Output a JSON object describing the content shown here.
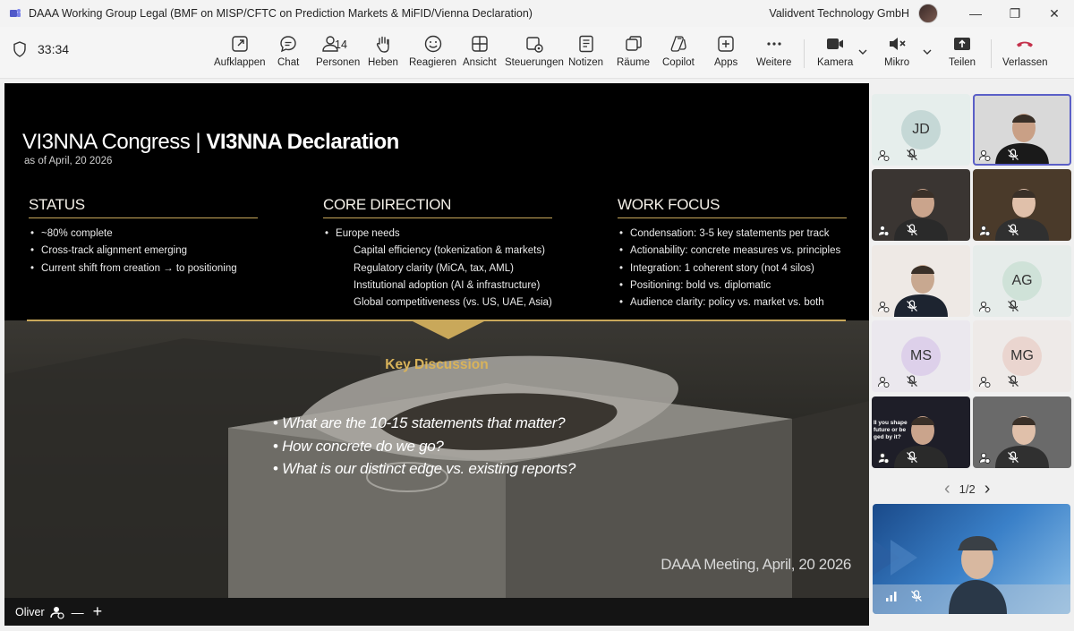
{
  "window": {
    "title": "DAAA Working Group Legal (BMF on MISP/CFTC on Prediction Markets & MiFID/Vienna Declaration)",
    "org": "Validvent Technology GmbH",
    "minimize_glyph": "—",
    "restore_glyph": "❐",
    "close_glyph": "✕"
  },
  "toolbar": {
    "timer": "33:34",
    "buttons": [
      {
        "label": "Aufklappen",
        "icon": "popout-icon"
      },
      {
        "label": "Chat",
        "icon": "chat-icon"
      },
      {
        "label": "Personen",
        "icon": "people-icon",
        "count": "14"
      },
      {
        "label": "Heben",
        "icon": "raise-hand-icon"
      },
      {
        "label": "Reagieren",
        "icon": "smiley-icon"
      },
      {
        "label": "Ansicht",
        "icon": "grid-view-icon"
      },
      {
        "label": "Steuerungen",
        "icon": "controls-icon"
      },
      {
        "label": "Notizen",
        "icon": "notes-icon"
      },
      {
        "label": "Räume",
        "icon": "rooms-icon"
      },
      {
        "label": "Copilot",
        "icon": "copilot-icon"
      },
      {
        "label": "Apps",
        "icon": "apps-icon"
      },
      {
        "label": "Weitere",
        "icon": "more-icon"
      }
    ],
    "kamera": "Kamera",
    "mikro": "Mikro",
    "teilen": "Teilen",
    "verlassen": "Verlassen",
    "leave_color": "#c4314b"
  },
  "slide": {
    "title_light": "VI3NNA Congress | ",
    "title_bold": "VI3NNA Declaration",
    "date": "as of April, 20 2026",
    "columns": [
      {
        "heading": "STATUS",
        "items": [
          {
            "text": "~80% complete",
            "sub": false
          },
          {
            "text": "Cross-track alignment emerging",
            "sub": false
          },
          {
            "text": "Current shift from creation → to positioning",
            "sub": false
          }
        ]
      },
      {
        "heading": "CORE DIRECTION",
        "items": [
          {
            "text": "Europe needs",
            "sub": false
          },
          {
            "text": "Capital efficiency (tokenization & markets)",
            "sub": true
          },
          {
            "text": "Regulatory clarity (MiCA, tax, AML)",
            "sub": true
          },
          {
            "text": "Institutional adoption (AI & infrastructure)",
            "sub": true
          },
          {
            "text": "Global competitiveness (vs. US, UAE, Asia)",
            "sub": true
          }
        ]
      },
      {
        "heading": "WORK FOCUS",
        "items": [
          {
            "text": "Condensation: 3-5 key statements per track",
            "sub": false
          },
          {
            "text": "Actionability: concrete measures vs. principles",
            "sub": false
          },
          {
            "text": "Integration: 1 coherent story (not 4 silos)",
            "sub": false
          },
          {
            "text": "Positioning: bold vs. diplomatic",
            "sub": false
          },
          {
            "text": "Audience clarity: policy vs. market vs. both",
            "sub": false
          }
        ]
      }
    ],
    "key_discussion": "Key Discussion",
    "questions": [
      "What are the 10-15 statements that matter?",
      "How concrete do we go?",
      "What is our distinct edge vs. existing reports?"
    ],
    "footer": "DAAA Meeting, April, 20 2026",
    "accent": "#c9a85a"
  },
  "presenter": {
    "name": "Oliver",
    "minus": "—",
    "plus": "+"
  },
  "participants": [
    {
      "initials": "JD",
      "bg": "#e6eeec",
      "circle": "#c5d8d6",
      "video": false,
      "selected": false
    },
    {
      "initials": "",
      "bg": "#d9d9d9",
      "video": true,
      "selected": true
    },
    {
      "initials": "",
      "bg": "#3a3532",
      "video": true,
      "selected": false
    },
    {
      "initials": "",
      "bg": "#4a3a2a",
      "video": true,
      "selected": false
    },
    {
      "initials": "",
      "bg": "#eee9e5",
      "video": true,
      "selected": false
    },
    {
      "initials": "AG",
      "bg": "#e6ecea",
      "circle": "#cfe2d8",
      "video": false,
      "selected": false
    },
    {
      "initials": "MS",
      "bg": "#ebe8ee",
      "circle": "#ddd0ea",
      "video": false,
      "selected": false
    },
    {
      "initials": "MG",
      "bg": "#eeeae8",
      "circle": "#ead5cf",
      "video": false,
      "selected": false
    },
    {
      "initials": "",
      "bg": "#1e1e28",
      "video": true,
      "selected": false,
      "overlay": "Il you shape\nfuture or be\nged by it?"
    },
    {
      "initials": "",
      "bg": "#6a6a6a",
      "video": true,
      "selected": false
    }
  ],
  "pager": {
    "text": "1/2",
    "prev": "‹",
    "next": "›"
  }
}
